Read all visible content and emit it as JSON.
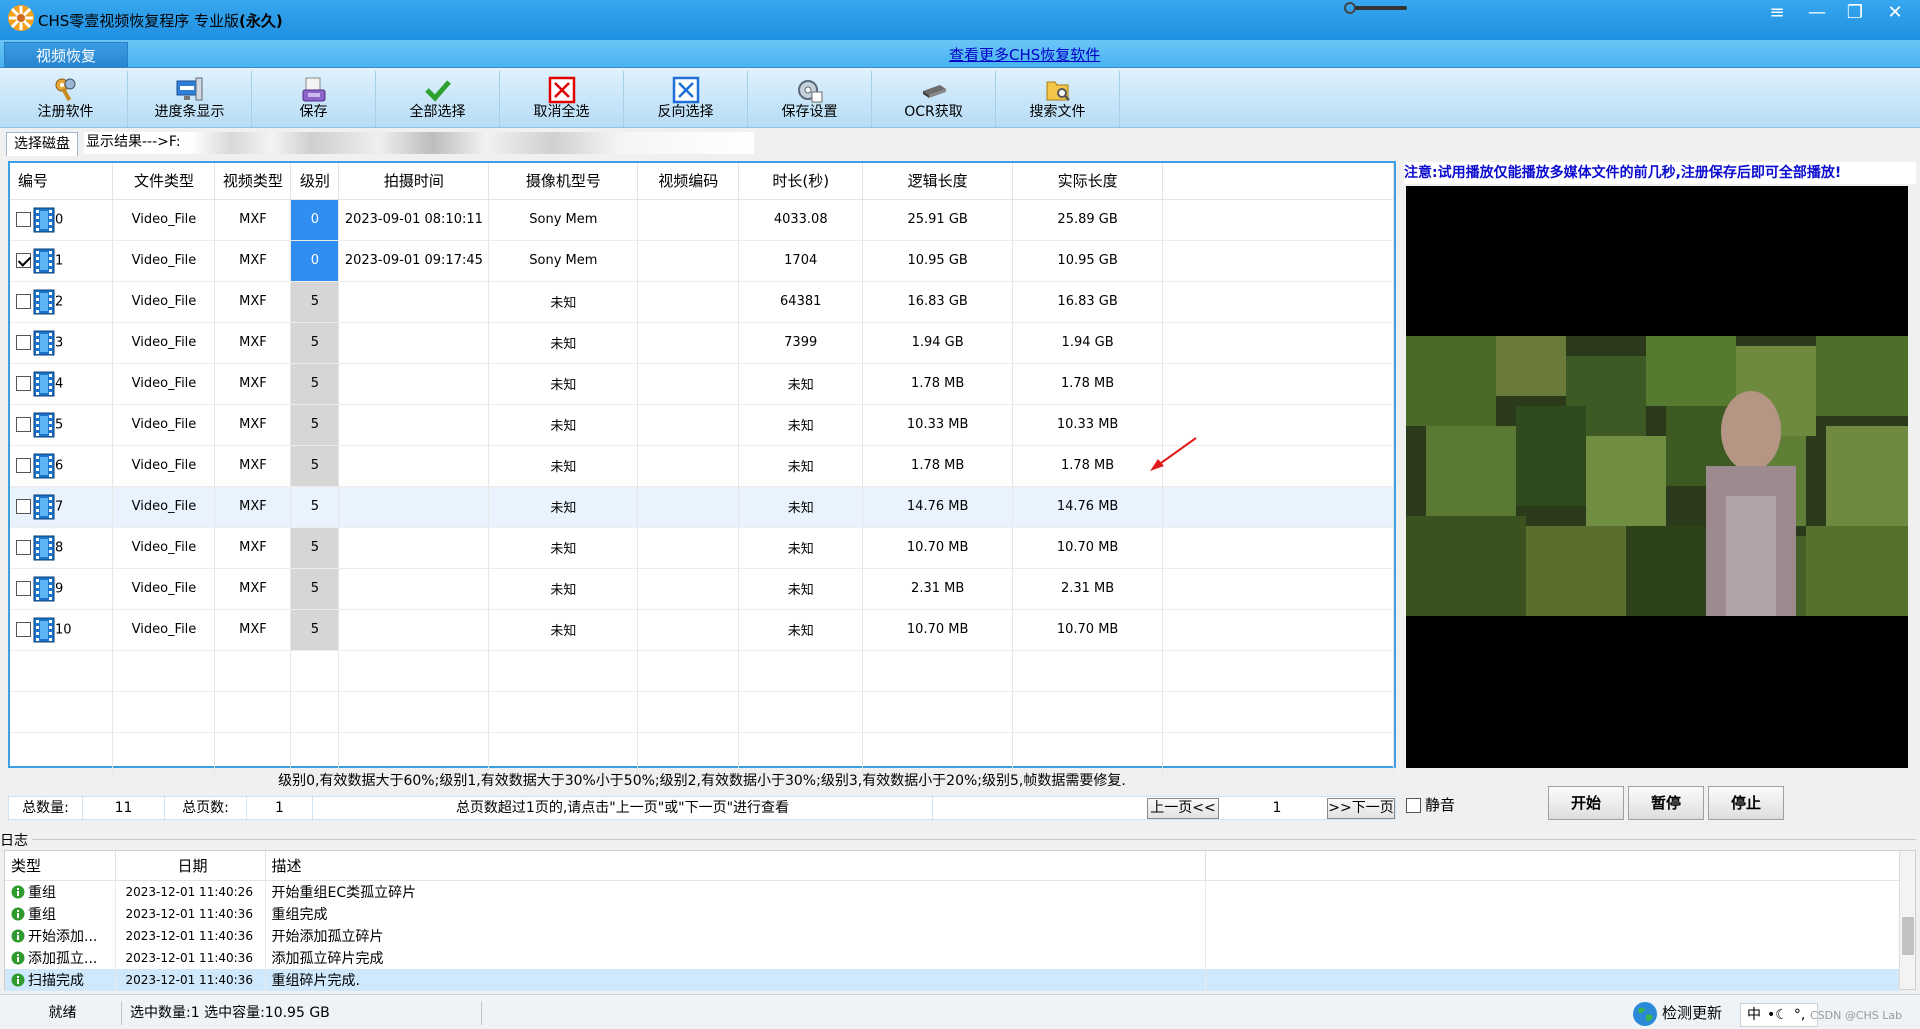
{
  "window": {
    "title_prefix": "CHS零壹视频恢复程序 专业版",
    "title_suffix": "(永久)",
    "controls": [
      "≡",
      "—",
      "❐",
      "✕"
    ]
  },
  "tabs": {
    "active": "视频恢复",
    "more_link": "查看更多CHS恢复软件"
  },
  "toolbar": [
    {
      "label": "注册软件",
      "icon": "keys-icon"
    },
    {
      "label": "进度条显示",
      "icon": "monitor-icon"
    },
    {
      "label": "保存",
      "icon": "disk-save-icon"
    },
    {
      "label": "全部选择",
      "icon": "check-icon"
    },
    {
      "label": "取消全选",
      "icon": "red-x-icon"
    },
    {
      "label": "反向选择",
      "icon": "blue-x-icon"
    },
    {
      "label": "保存设置",
      "icon": "save-settings-icon"
    },
    {
      "label": "OCR获取",
      "icon": "scanner-icon"
    },
    {
      "label": "搜索文件",
      "icon": "folder-search-icon"
    }
  ],
  "disk": {
    "tab_label": "选择磁盘",
    "path": "显示结果--->F:"
  },
  "file_table": {
    "headers": [
      "编号",
      "文件类型",
      "视频类型",
      "级别",
      "拍摄时间",
      "摄像机型号",
      "视频编码",
      "时长(秒)",
      "逻辑长度",
      "实际长度"
    ],
    "rows": [
      {
        "id": "0",
        "type": "Video_File",
        "vtype": "MXF",
        "level": "0",
        "time": "2023-09-01 08:10:11",
        "camera": "Sony Mem",
        "codec": "",
        "duration": "4033.08",
        "logical": "25.91 GB",
        "actual": "25.89 GB",
        "checked": false
      },
      {
        "id": "1",
        "type": "Video_File",
        "vtype": "MXF",
        "level": "0",
        "time": "2023-09-01 09:17:45",
        "camera": "Sony Mem",
        "codec": "",
        "duration": "1704",
        "logical": "10.95 GB",
        "actual": "10.95 GB",
        "checked": true
      },
      {
        "id": "2",
        "type": "Video_File",
        "vtype": "MXF",
        "level": "5",
        "time": "",
        "camera": "未知",
        "codec": "",
        "duration": "64381",
        "logical": "16.83 GB",
        "actual": "16.83 GB",
        "checked": false
      },
      {
        "id": "3",
        "type": "Video_File",
        "vtype": "MXF",
        "level": "5",
        "time": "",
        "camera": "未知",
        "codec": "",
        "duration": "7399",
        "logical": "1.94 GB",
        "actual": "1.94 GB",
        "checked": false
      },
      {
        "id": "4",
        "type": "Video_File",
        "vtype": "MXF",
        "level": "5",
        "time": "",
        "camera": "未知",
        "codec": "",
        "duration": "未知",
        "logical": "1.78 MB",
        "actual": "1.78 MB",
        "checked": false
      },
      {
        "id": "5",
        "type": "Video_File",
        "vtype": "MXF",
        "level": "5",
        "time": "",
        "camera": "未知",
        "codec": "",
        "duration": "未知",
        "logical": "10.33 MB",
        "actual": "10.33 MB",
        "checked": false
      },
      {
        "id": "6",
        "type": "Video_File",
        "vtype": "MXF",
        "level": "5",
        "time": "",
        "camera": "未知",
        "codec": "",
        "duration": "未知",
        "logical": "1.78 MB",
        "actual": "1.78 MB",
        "checked": false
      },
      {
        "id": "7",
        "type": "Video_File",
        "vtype": "MXF",
        "level": "5",
        "time": "",
        "camera": "未知",
        "codec": "",
        "duration": "未知",
        "logical": "14.76 MB",
        "actual": "14.76 MB",
        "checked": false,
        "highlight": true
      },
      {
        "id": "8",
        "type": "Video_File",
        "vtype": "MXF",
        "level": "5",
        "time": "",
        "camera": "未知",
        "codec": "",
        "duration": "未知",
        "logical": "10.70 MB",
        "actual": "10.70 MB",
        "checked": false
      },
      {
        "id": "9",
        "type": "Video_File",
        "vtype": "MXF",
        "level": "5",
        "time": "",
        "camera": "未知",
        "codec": "",
        "duration": "未知",
        "logical": "2.31 MB",
        "actual": "2.31 MB",
        "checked": false
      },
      {
        "id": "10",
        "type": "Video_File",
        "vtype": "MXF",
        "level": "5",
        "time": "",
        "camera": "未知",
        "codec": "",
        "duration": "未知",
        "logical": "10.70 MB",
        "actual": "10.70 MB",
        "checked": false
      }
    ]
  },
  "level_note": "级别0,有效数据大于60%;级别1,有效数据大于30%小于50%;级别2,有效数据小于30%;级别3,有效数据小于20%;级别5,帧数据需要修复.",
  "pager": {
    "total_label": "总数量:",
    "total_value": "11",
    "pages_label": "总页数:",
    "pages_value": "1",
    "hint": "总页数超过1页的,请点击\"上一页\"或\"下一页\"进行查看",
    "prev": "上一页<<",
    "page": "1",
    "next": ">>下一页"
  },
  "preview": {
    "notice": "注意:试用播放仅能播放多媒体文件的前几秒,注册保存后即可全部播放!",
    "mute": "静音",
    "start": "开始",
    "pause": "暂停",
    "stop": "停止"
  },
  "log": {
    "title": "日志",
    "headers": [
      "类型",
      "日期",
      "描述"
    ],
    "rows": [
      {
        "type": "重组",
        "date": "2023-12-01 11:40:26",
        "desc": "开始重组EC类孤立碎片"
      },
      {
        "type": "重组",
        "date": "2023-12-01 11:40:36",
        "desc": "重组完成"
      },
      {
        "type": "开始添加...",
        "date": "2023-12-01 11:40:36",
        "desc": "开始添加孤立碎片"
      },
      {
        "type": "添加孤立...",
        "date": "2023-12-01 11:40:36",
        "desc": "添加孤立碎片完成"
      },
      {
        "type": "扫描完成",
        "date": "2023-12-01 11:40:36",
        "desc": "重组碎片完成.",
        "selected": true
      }
    ]
  },
  "status": {
    "ready": "就绪",
    "selection": "选中数量:1 选中容量:10.95 GB",
    "update": "检测更新",
    "ime": [
      "中",
      "•☾",
      "°,"
    ],
    "watermark": "CSDN @CHS Lab"
  },
  "colors": {
    "accent": "#2f8ef0",
    "title_bar": "#1f8fe0",
    "notice": "#0a0ad0"
  }
}
